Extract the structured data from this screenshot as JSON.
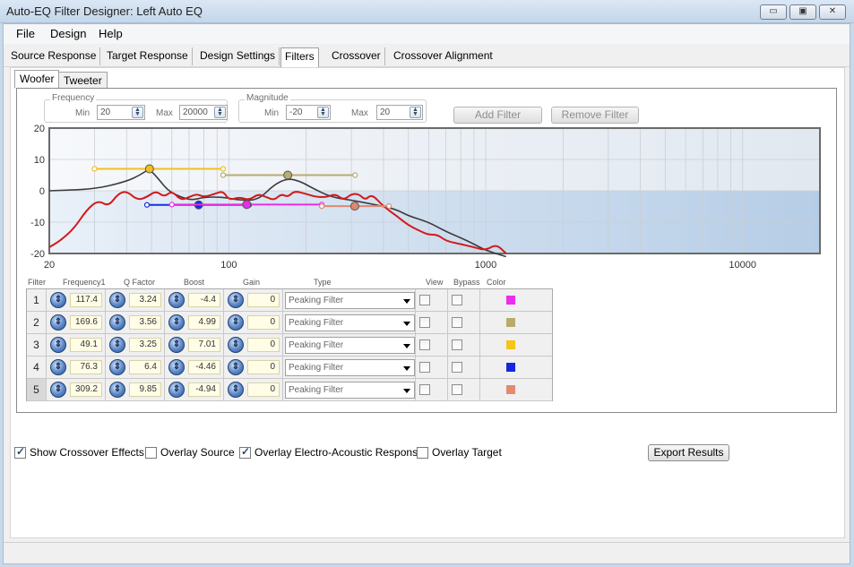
{
  "window": {
    "title": "Auto-EQ Filter Designer: Left Auto EQ",
    "min_glyph": "▭",
    "max_glyph": "▣",
    "close_glyph": "✕"
  },
  "menu": [
    "File",
    "Design",
    "Help"
  ],
  "tabs": [
    "Source Response",
    "Target Response",
    "Design Settings",
    "Filters",
    "Crossover",
    "Crossover Alignment"
  ],
  "selected_tab": "Filters",
  "subtabs": [
    "Woofer",
    "Tweeter"
  ],
  "frequency": {
    "group": "Frequency",
    "min_label": "Min",
    "min": "20",
    "max_label": "Max",
    "max": "20000"
  },
  "magnitude": {
    "group": "Magnitude",
    "min_label": "Min",
    "min": "-20",
    "max_label": "Max",
    "max": "20"
  },
  "buttons": {
    "add_filter": "Add Filter",
    "remove_filter": "Remove Filter",
    "export": "Export Results"
  },
  "chart_data": {
    "type": "line",
    "xscale": "log",
    "xlim": [
      20,
      20000
    ],
    "ylim": [
      -20,
      20
    ],
    "x_ticks": [
      "20",
      "100",
      "1000",
      "10000"
    ],
    "y_ticks": [
      "20",
      "10",
      "0",
      "-10",
      "-20"
    ],
    "series": [
      {
        "color": "#d11a1a",
        "x": [
          20,
          22,
          25,
          28,
          31,
          34,
          37,
          40,
          44,
          48,
          52,
          56,
          60,
          65,
          70,
          75,
          80,
          88,
          95,
          100,
          110,
          120,
          130,
          140,
          150,
          160,
          170,
          180,
          200,
          220,
          240,
          260,
          280,
          300,
          320,
          340,
          360,
          400,
          450,
          500,
          560,
          600,
          650,
          700,
          800,
          900,
          1000,
          1100,
          1200
        ],
        "y": [
          -18,
          -16,
          -12,
          -6,
          -3,
          -5,
          -1,
          0,
          -3,
          -2,
          0,
          -2,
          0,
          -3,
          -2,
          -1,
          -2,
          -1,
          0,
          -3,
          -2,
          -3,
          -1,
          -2,
          -3,
          -1,
          -2,
          0,
          -1,
          -2,
          -2,
          -1,
          -3,
          -1,
          -1,
          -3,
          -1,
          -5,
          -8,
          -11,
          -13,
          -14,
          -14,
          -16,
          -17,
          -18,
          -19,
          -17,
          -20
        ]
      },
      {
        "color": "#3c3c3c",
        "x": [
          20,
          30,
          40,
          45,
          49,
          53,
          58,
          65,
          72,
          80,
          95,
          110,
          130,
          150,
          170,
          190,
          210,
          250,
          300,
          350,
          400,
          450,
          500,
          600,
          700,
          800,
          900,
          1000,
          1200
        ],
        "y": [
          0,
          0.5,
          3,
          5,
          7,
          4,
          0,
          -2,
          -3,
          -2,
          -2,
          -3,
          -3,
          2,
          4,
          3,
          1,
          -2,
          -3,
          -4,
          -5,
          -6,
          -8,
          -10,
          -13,
          -15,
          -17,
          -19,
          -21
        ]
      }
    ],
    "filter_handles": [
      {
        "id": 3,
        "x": 49.1,
        "y": 7,
        "x0": 30,
        "x1": 95,
        "color": "#f0c020"
      },
      {
        "id": 2,
        "x": 169.6,
        "y": 5,
        "x0": 95,
        "x1": 310,
        "color": "#b8ac70"
      },
      {
        "id": 4,
        "x": 76.3,
        "y": -4.5,
        "x0": 48,
        "x1": 120,
        "color": "#1230e0"
      },
      {
        "id": 1,
        "x": 117.4,
        "y": -4.4,
        "x0": 60,
        "x1": 230,
        "color": "#e62ee6"
      },
      {
        "id": 5,
        "x": 309.2,
        "y": -4.9,
        "x0": 230,
        "x1": 420,
        "color": "#e08870"
      }
    ]
  },
  "table": {
    "headers": [
      "Filter",
      "Frequency1",
      "Q Factor",
      "Boost",
      "Gain",
      "Type",
      "View",
      "Bypass",
      "Color"
    ],
    "rows": [
      {
        "n": "1",
        "freq": "117.4",
        "q": "3.24",
        "boost": "-4.4",
        "gain": "0",
        "type": "Peaking Filter",
        "color": "#ee2cee"
      },
      {
        "n": "2",
        "freq": "169.6",
        "q": "3.56",
        "boost": "4.99",
        "gain": "0",
        "type": "Peaking Filter",
        "color": "#b8ab6e"
      },
      {
        "n": "3",
        "freq": "49.1",
        "q": "3.25",
        "boost": "7.01",
        "gain": "0",
        "type": "Peaking Filter",
        "color": "#f5c518"
      },
      {
        "n": "4",
        "freq": "76.3",
        "q": "6.4",
        "boost": "-4.46",
        "gain": "0",
        "type": "Peaking Filter",
        "color": "#1428e0"
      },
      {
        "n": "5",
        "freq": "309.2",
        "q": "9.85",
        "boost": "-4.94",
        "gain": "0",
        "type": "Peaking Filter",
        "color": "#e38a72"
      }
    ]
  },
  "options": [
    {
      "label": "Show Crossover Effects",
      "checked": true
    },
    {
      "label": "Overlay Source",
      "checked": false
    },
    {
      "label": "Overlay Electro-Acoustic Response",
      "checked": true
    },
    {
      "label": "Overlay Target",
      "checked": false
    }
  ],
  "glyphs": {
    "spin_up": "▲",
    "spin_down": "▼",
    "knob": "⇕"
  }
}
